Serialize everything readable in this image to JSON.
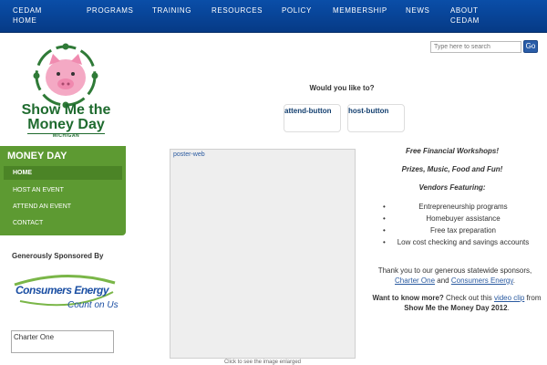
{
  "nav": {
    "items": [
      {
        "label": "CEDAM HOME"
      },
      {
        "label": "PROGRAMS"
      },
      {
        "label": "TRAINING"
      },
      {
        "label": "RESOURCES"
      },
      {
        "label": "POLICY"
      },
      {
        "label": "MEMBERSHIP"
      },
      {
        "label": "NEWS"
      },
      {
        "label": "ABOUT CEDAM"
      }
    ]
  },
  "search": {
    "placeholder": "Type here to search",
    "go_label": "Go"
  },
  "logo": {
    "line1": "Show Me the",
    "line2": "Money Day",
    "sub": "MICHIGAN"
  },
  "menu": {
    "title": "MONEY DAY",
    "items": [
      {
        "label": "HOME"
      },
      {
        "label": "HOST AN EVENT"
      },
      {
        "label": "ATTEND AN EVENT"
      },
      {
        "label": "CONTACT"
      }
    ]
  },
  "sponsors": {
    "heading": "Generously Sponsored By",
    "consumers_name": "Consumers Energy",
    "consumers_tag": "Count on Us",
    "charter_alt": "Charter One"
  },
  "main": {
    "question": "Would you like to?",
    "attend_label": "attend-button",
    "host_label": "host-button",
    "poster_alt": "poster-web",
    "poster_caption": "Click to see the image enlarged"
  },
  "right": {
    "headline1": "Free Financial Workshops!",
    "headline2": "Prizes, Music, Food and Fun!",
    "headline3": "Vendors Featuring:",
    "vendors": [
      {
        "label": "Entrepreneurship programs"
      },
      {
        "label": "Homebuyer assistance"
      },
      {
        "label": "Free tax preparation"
      },
      {
        "label": "Low cost checking and savings accounts"
      }
    ],
    "thanks_pre": "Thank you to our generous statewide sponsors, ",
    "thanks_link1": "Charter One",
    "thanks_and": " and ",
    "thanks_link2": "Consumers Energy",
    "thanks_end": ".",
    "more_bold": "Want to know more?",
    "more_text": " Check out this ",
    "more_link": "video clip",
    "more_from": " from ",
    "more_event": "Show Me the Money Day 2012",
    "more_end": "."
  },
  "colors": {
    "nav_blue": "#0a4ea8",
    "menu_green": "#5d9a32",
    "logo_green": "#1f6b2f",
    "link_blue": "#2a5aa0",
    "pig_pink": "#f4a9c4"
  }
}
